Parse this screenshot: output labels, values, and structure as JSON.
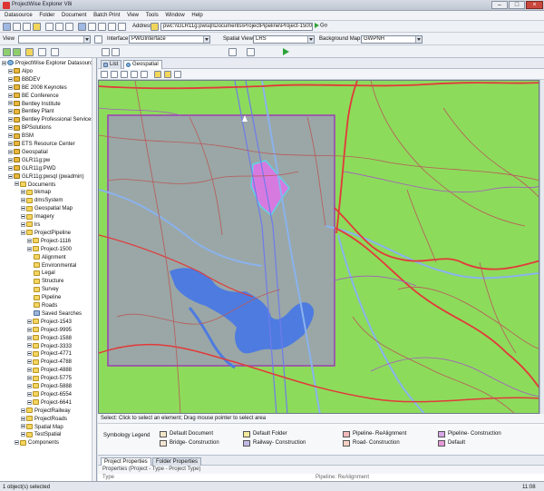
{
  "window": {
    "title": "ProjectWise Explorer V8i"
  },
  "menu": [
    "Datasource",
    "Folder",
    "Document",
    "Batch Print",
    "View",
    "Tools",
    "Window",
    "Help"
  ],
  "toolbar": {
    "address_label": "Address",
    "address_value": "pwc:\\\\GLR11g:pwsql\\Documents\\ProjectPipeline\\Project-1500",
    "go_label": "Go",
    "interface_label": "Interface",
    "interface_value": "PWGInterface",
    "spatial_view_label": "Spatial View:",
    "spatial_view_value": "LRS",
    "background_map_label": "Background Map:",
    "background_map_value": "GWPNH",
    "view_label": "View"
  },
  "tree": {
    "root": "ProjectWise Explorer Datasources",
    "datasources": [
      "Alpo",
      "BBDEV",
      "BE 2008 Keynotes",
      "BE Conference",
      "Bentley Institute",
      "Bentley Plant",
      "Bentley Professional Services",
      "BPSolutions",
      "BSM",
      "ETS Resource Center",
      "Geospatial",
      "GLR11g:pw",
      "GLR11g:PWD",
      "GLR11g:pwsql (pwadmin)"
    ],
    "documents": "Documents",
    "doc_folders": [
      "bkmap",
      "dmsSystem",
      "Geospatial Map",
      "Imagery",
      "lrs"
    ],
    "project_pipeline": "ProjectPipeline",
    "projects_a": [
      "Project-1116",
      "Project-1500"
    ],
    "project_1500_children": [
      "Alignment",
      "Environmental",
      "Legal",
      "Structure",
      "Survey",
      "Pipeline",
      "Roads",
      "Saved Searches"
    ],
    "projects_b": [
      "Project-1543",
      "Project-9995",
      "Project-1588",
      "Project-3333",
      "Project-4771",
      "Project-4788",
      "Project-4888",
      "Project-5775",
      "Project-5888",
      "Project-6554",
      "Project-6641"
    ],
    "bottom_folders": [
      "ProjectRailway",
      "ProjectRoads",
      "Spatial Map",
      "TestSpatial"
    ],
    "components": "Components"
  },
  "tabs": {
    "list": "List",
    "geospatial": "Geospatial"
  },
  "select_hint": "Select: Click to select an element; Drag mouse pointer to select area",
  "legend": {
    "title": "Symbology Legend",
    "items": [
      {
        "label": "Default Document",
        "color": "#f1e6c8"
      },
      {
        "label": "Default Folder",
        "color": "#f2e99a"
      },
      {
        "label": "Pipeline- ReAlignment",
        "color": "#f3b9b9"
      },
      {
        "label": "Pipeline- Construction",
        "color": "#d7a6e6"
      },
      {
        "label": "Bridge- Construction",
        "color": "#f2e6d2"
      },
      {
        "label": "Railway- Construction",
        "color": "#c2b9e6"
      },
      {
        "label": "Road- Construction",
        "color": "#f7d0c2"
      },
      {
        "label": "Default",
        "color": "#e59ad8"
      }
    ]
  },
  "prop_tabs": {
    "project": "Project Properties",
    "folder": "Folder Properties"
  },
  "prop_row": "Properties (Project - Type - Project Type)",
  "prop_cut_left": "Type",
  "prop_cut_right": "Pipeline: ReAlignment",
  "status": {
    "selected": "1 object(s) selected",
    "time": "11:08"
  },
  "colors": {
    "map_land": "#8ddb5b",
    "study_area": "#9aa7a6",
    "water": "#4e7be0",
    "highlight": "#d77ae0"
  }
}
